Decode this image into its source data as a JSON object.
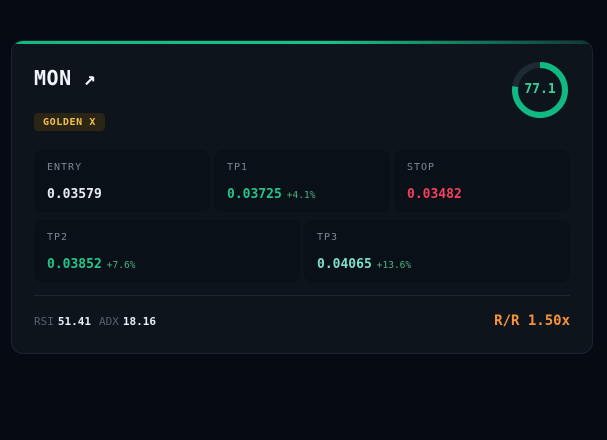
{
  "card": {
    "symbol": "MON",
    "trend_arrow": "↗",
    "trend_icon": "arrow-up-right-icon",
    "badge": "GOLDEN X",
    "score": {
      "value": 77.1,
      "max": 100,
      "label": "77.1",
      "color": "#10b981",
      "track_color": "#1e2a33"
    },
    "levels": {
      "entry": {
        "label": "ENTRY",
        "price": "0.03579"
      },
      "tp1": {
        "label": "TP1",
        "price": "0.03725",
        "change": "+4.1%"
      },
      "stop": {
        "label": "STOP",
        "price": "0.03482"
      },
      "tp2": {
        "label": "TP2",
        "price": "0.03852",
        "change": "+7.6%"
      },
      "tp3": {
        "label": "TP3",
        "price": "0.04065",
        "change": "+13.6%"
      }
    },
    "indicators": {
      "rsi_label": "RSI",
      "rsi_value": "51.41",
      "adx_label": "ADX",
      "adx_value": "18.16"
    },
    "risk_reward": "R/R 1.50x"
  },
  "colors": {
    "accent_green": "#10b981",
    "tp_green": "#22c58b",
    "tp3_mint": "#7ee0c4",
    "stop_red": "#f43f5e",
    "gold": "#f5c04a",
    "orange": "#f5923a"
  }
}
